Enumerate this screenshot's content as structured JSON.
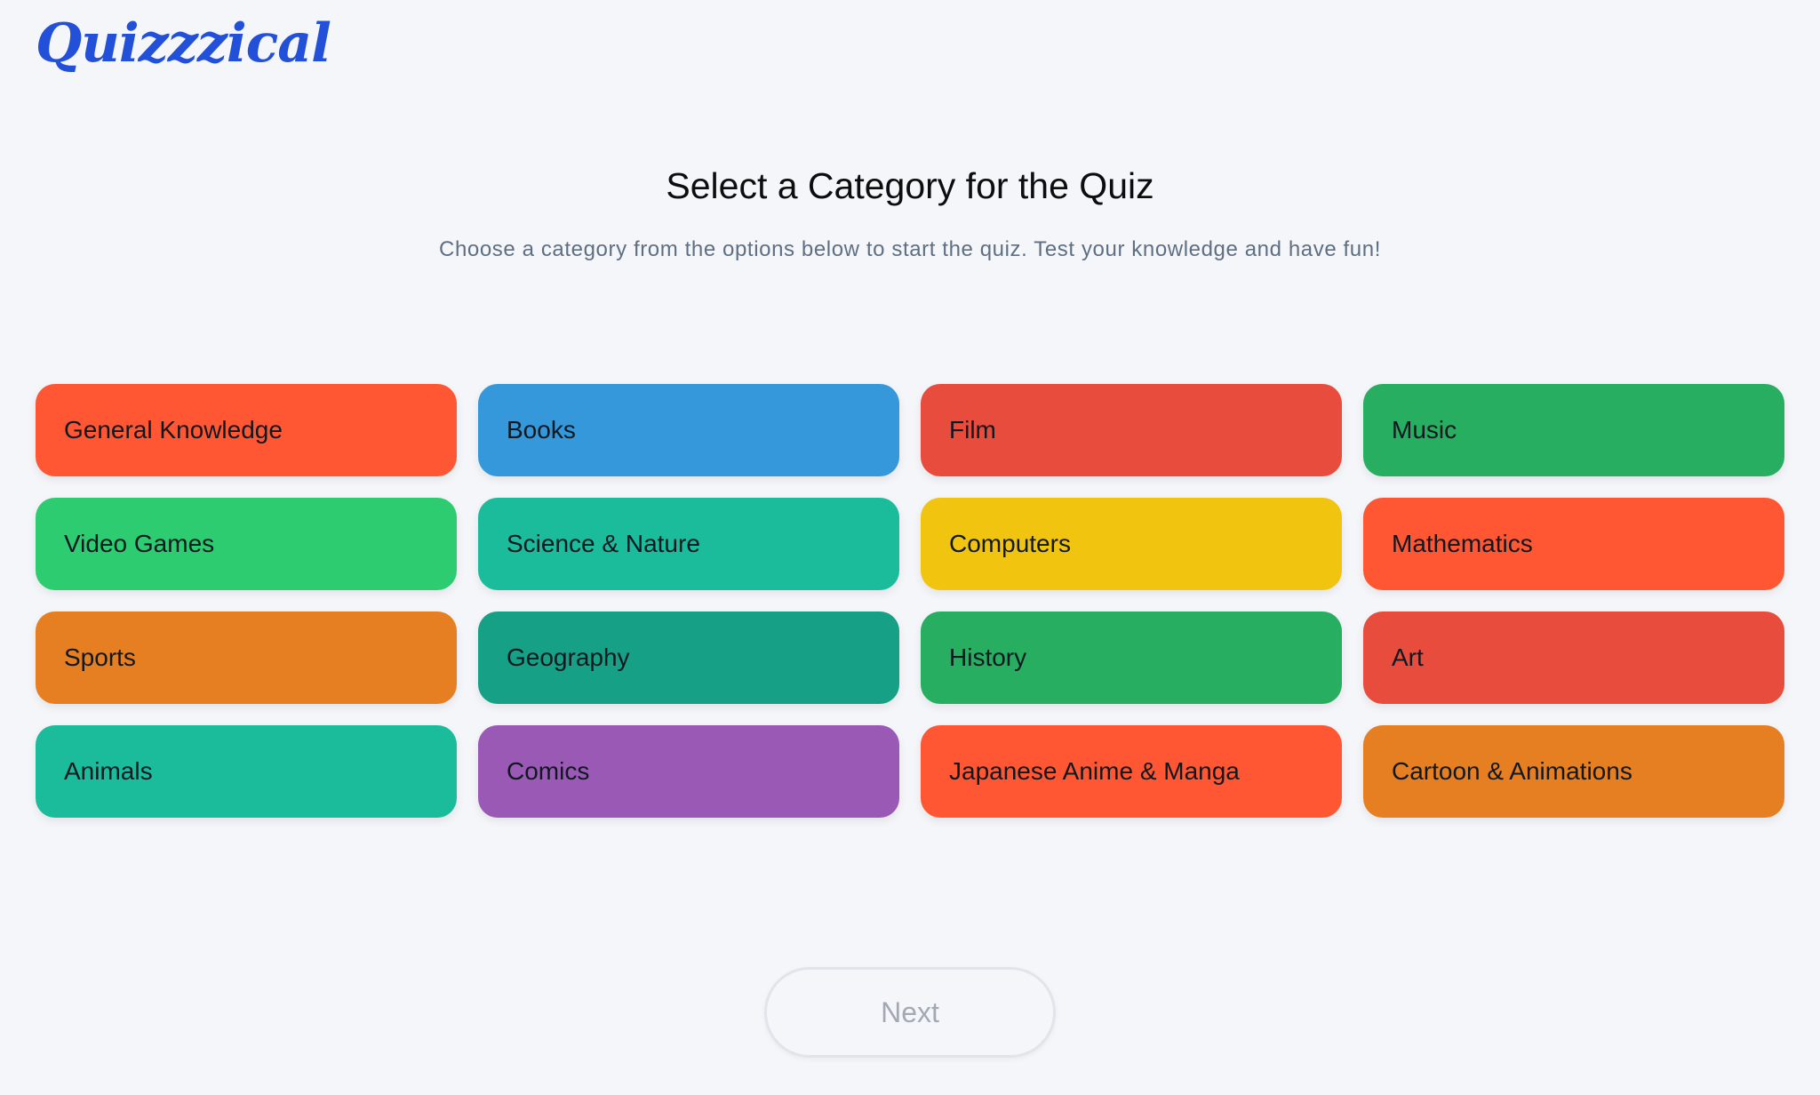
{
  "header": {
    "logo": "Quizzzical"
  },
  "main": {
    "title": "Select a Category for the Quiz",
    "subtitle": "Choose a category from the options below to start the quiz. Test your knowledge and have fun!"
  },
  "categories": [
    {
      "label": "General Knowledge",
      "color": "#ff5733"
    },
    {
      "label": "Books",
      "color": "#3498db"
    },
    {
      "label": "Film",
      "color": "#e74c3c"
    },
    {
      "label": "Music",
      "color": "#27ae60"
    },
    {
      "label": "Video Games",
      "color": "#2ecc71"
    },
    {
      "label": "Science & Nature",
      "color": "#1abc9c"
    },
    {
      "label": "Computers",
      "color": "#f1c40f"
    },
    {
      "label": "Mathematics",
      "color": "#ff5733"
    },
    {
      "label": "Sports",
      "color": "#e67e22"
    },
    {
      "label": "Geography",
      "color": "#16a085"
    },
    {
      "label": "History",
      "color": "#27ae60"
    },
    {
      "label": "Art",
      "color": "#e74c3c"
    },
    {
      "label": "Animals",
      "color": "#1abc9c"
    },
    {
      "label": "Comics",
      "color": "#9b59b6"
    },
    {
      "label": "Japanese Anime & Manga",
      "color": "#ff5733"
    },
    {
      "label": "Cartoon & Animations",
      "color": "#e67e22"
    }
  ],
  "footer": {
    "next_label": "Next"
  },
  "colors": {
    "brand": "#2350d8",
    "background": "#f5f6fa",
    "next_disabled_text": "#a2a9b4"
  }
}
